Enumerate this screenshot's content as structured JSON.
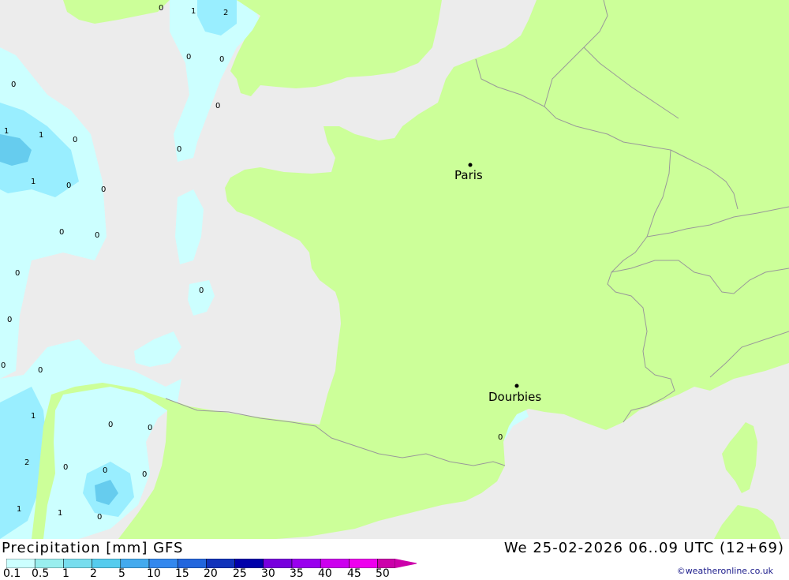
{
  "map": {
    "colors": {
      "sea": "#ececec",
      "land": "#ccff99",
      "border": "#999999",
      "precip_light": "#ccffff",
      "precip_mid": "#99eeff",
      "precip_dark": "#66ccee"
    },
    "cities": [
      {
        "name": "Paris"
      },
      {
        "name": "Dourbies"
      }
    ],
    "values": [
      "0",
      "1",
      "2",
      "0",
      "0",
      "0",
      "0",
      "1",
      "1",
      "0",
      "1",
      "0",
      "0",
      "0",
      "0",
      "0",
      "0",
      "0",
      "0",
      "0",
      "1",
      "2",
      "1",
      "0",
      "0",
      "0",
      "0",
      "0",
      "1",
      "0",
      "0"
    ]
  },
  "footer": {
    "title": "Precipitation [mm] GFS",
    "datetime": "We 25-02-2026 06..09 UTC (12+69)",
    "credit": "©weatheronline.co.uk"
  },
  "legend": {
    "ticks": [
      "0.1",
      "0.5",
      "1",
      "2",
      "5",
      "10",
      "15",
      "20",
      "25",
      "30",
      "35",
      "40",
      "45",
      "50"
    ],
    "colors": [
      "#ccffff",
      "#99eeee",
      "#77ddee",
      "#55ccee",
      "#44aaee",
      "#3388ee",
      "#2266dd",
      "#1133bb",
      "#0000aa",
      "#7700dd",
      "#9900ee",
      "#cc00ee",
      "#ee00ee",
      "#cc00aa"
    ]
  }
}
